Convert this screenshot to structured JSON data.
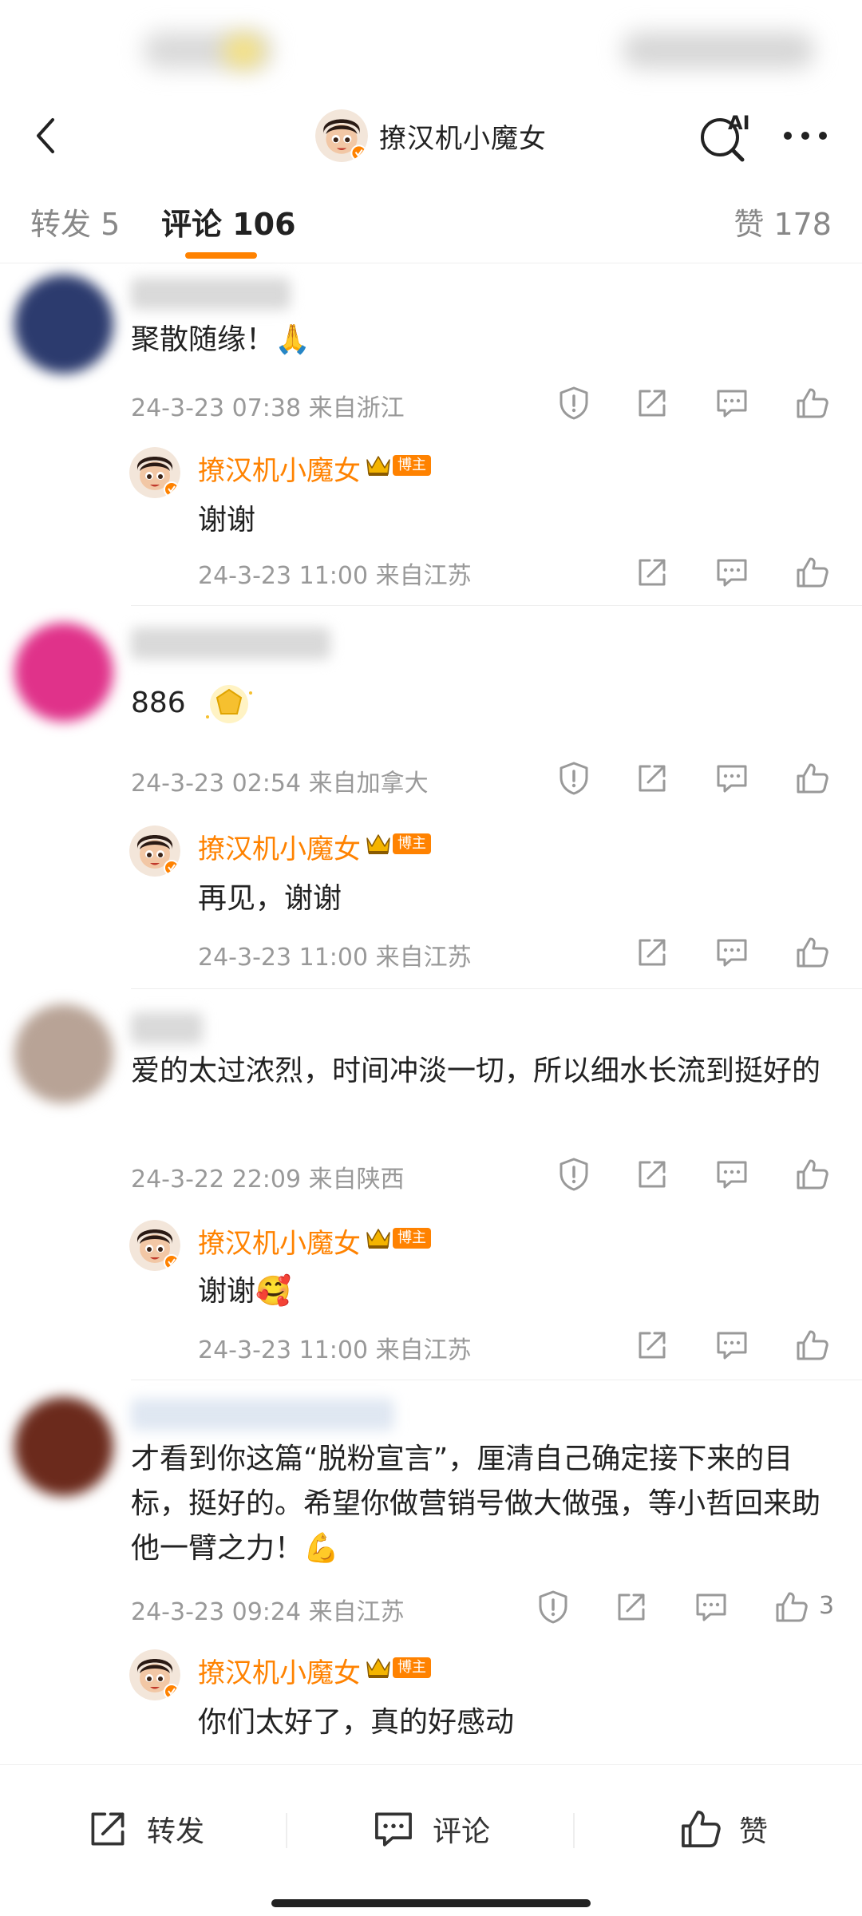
{
  "header": {
    "title": "撩汉机小魔女"
  },
  "tabs": {
    "repost": "转发 5",
    "comments": "评论 106",
    "likes": "赞 178"
  },
  "badge_label": "博主",
  "comments": [
    {
      "text": "聚散随缘！",
      "emoji": "🙏",
      "meta": "24-3-23 07:38  来自浙江",
      "reply": {
        "name": "撩汉机小魔女",
        "text": "谢谢",
        "meta": "24-3-23 11:00  来自江苏"
      }
    },
    {
      "text": "886",
      "meta": "24-3-23 02:54  来自加拿大",
      "reply": {
        "name": "撩汉机小魔女",
        "text": "再见，谢谢",
        "meta": "24-3-23 11:00  来自江苏"
      }
    },
    {
      "text": "爱的太过浓烈，时间冲淡一切，所以细水长流到挺好的",
      "meta": "24-3-22 22:09  来自陕西",
      "reply": {
        "name": "撩汉机小魔女",
        "text": "谢谢",
        "emoji": "🥰",
        "meta": "24-3-23 11:00  来自江苏"
      }
    },
    {
      "text": "才看到你这篇“脱粉宣言”，厘清自己确定接下来的目标，挺好的。希望你做营销号做大做强，等小哲回来助他一臂之力！",
      "emoji": "💪",
      "meta": "24-3-23 09:24  来自江苏",
      "like_count": "3",
      "reply": {
        "name": "撩汉机小魔女",
        "text": "你们太好了，真的好感动"
      }
    }
  ],
  "bottom_bar": {
    "repost": "转发",
    "comment": "评论",
    "like": "赞"
  },
  "colors": {
    "accent": "#ff8200",
    "meta_text": "#999999",
    "body_text": "#222222"
  }
}
